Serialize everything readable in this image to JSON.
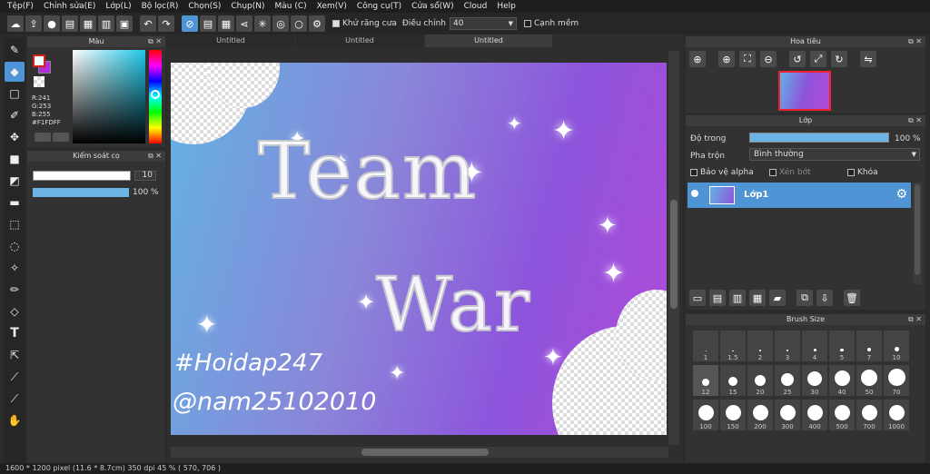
{
  "menu": [
    "Tệp(F)",
    "Chỉnh sửa(E)",
    "Lớp(L)",
    "Bộ lọc(R)",
    "Chọn(S)",
    "Chụp(N)",
    "Màu (C)",
    "Xem(V)",
    "Công cụ(T)",
    "Cửa sổ(W)",
    "Cloud",
    "Help"
  ],
  "toolbar": {
    "antialias_label": "Khử răng cưa",
    "adjust_label": "Điều chỉnh",
    "adjust_value": "40",
    "soft_edge_label": "Cạnh mềm"
  },
  "color_panel": {
    "title": "Màu",
    "r": "R:241",
    "g": "G:253",
    "b": "B:255",
    "hex": "#F1FDFF",
    "fg": "#F1FDFF",
    "bg": "#b02fd6"
  },
  "brush_ctrl": {
    "title": "Kiểm soát cọ",
    "size": "10",
    "opacity": "100 %"
  },
  "tabs": [
    "Untitled",
    "Untitled",
    "Untitled"
  ],
  "artwork": {
    "line1": "Team",
    "line2": "War",
    "tag1": "#Hoidap247",
    "tag2": "@nam25102010"
  },
  "navigator": {
    "title": "Hoa tiêu"
  },
  "layer_panel": {
    "title": "Lớp",
    "opacity_label": "Độ trong",
    "opacity_value": "100 %",
    "blend_label": "Pha trộn",
    "blend_value": "Bình thường",
    "protect_alpha": "Bảo vệ alpha",
    "clipping": "Xén bớt",
    "lock": "Khóa",
    "layer_name": "Lớp1"
  },
  "brush_size": {
    "title": "Brush Size",
    "sizes": [
      "1",
      "1.5",
      "2",
      "3",
      "4",
      "5",
      "7",
      "10",
      "12",
      "15",
      "20",
      "25",
      "30",
      "40",
      "50",
      "70",
      "100",
      "150",
      "200",
      "300",
      "400",
      "500",
      "700",
      "1000"
    ]
  },
  "status": {
    "text": "1600 * 1200 pixel   (11.6 * 8.7cm)  350 dpi   45 %   ( 570, 706 )"
  }
}
